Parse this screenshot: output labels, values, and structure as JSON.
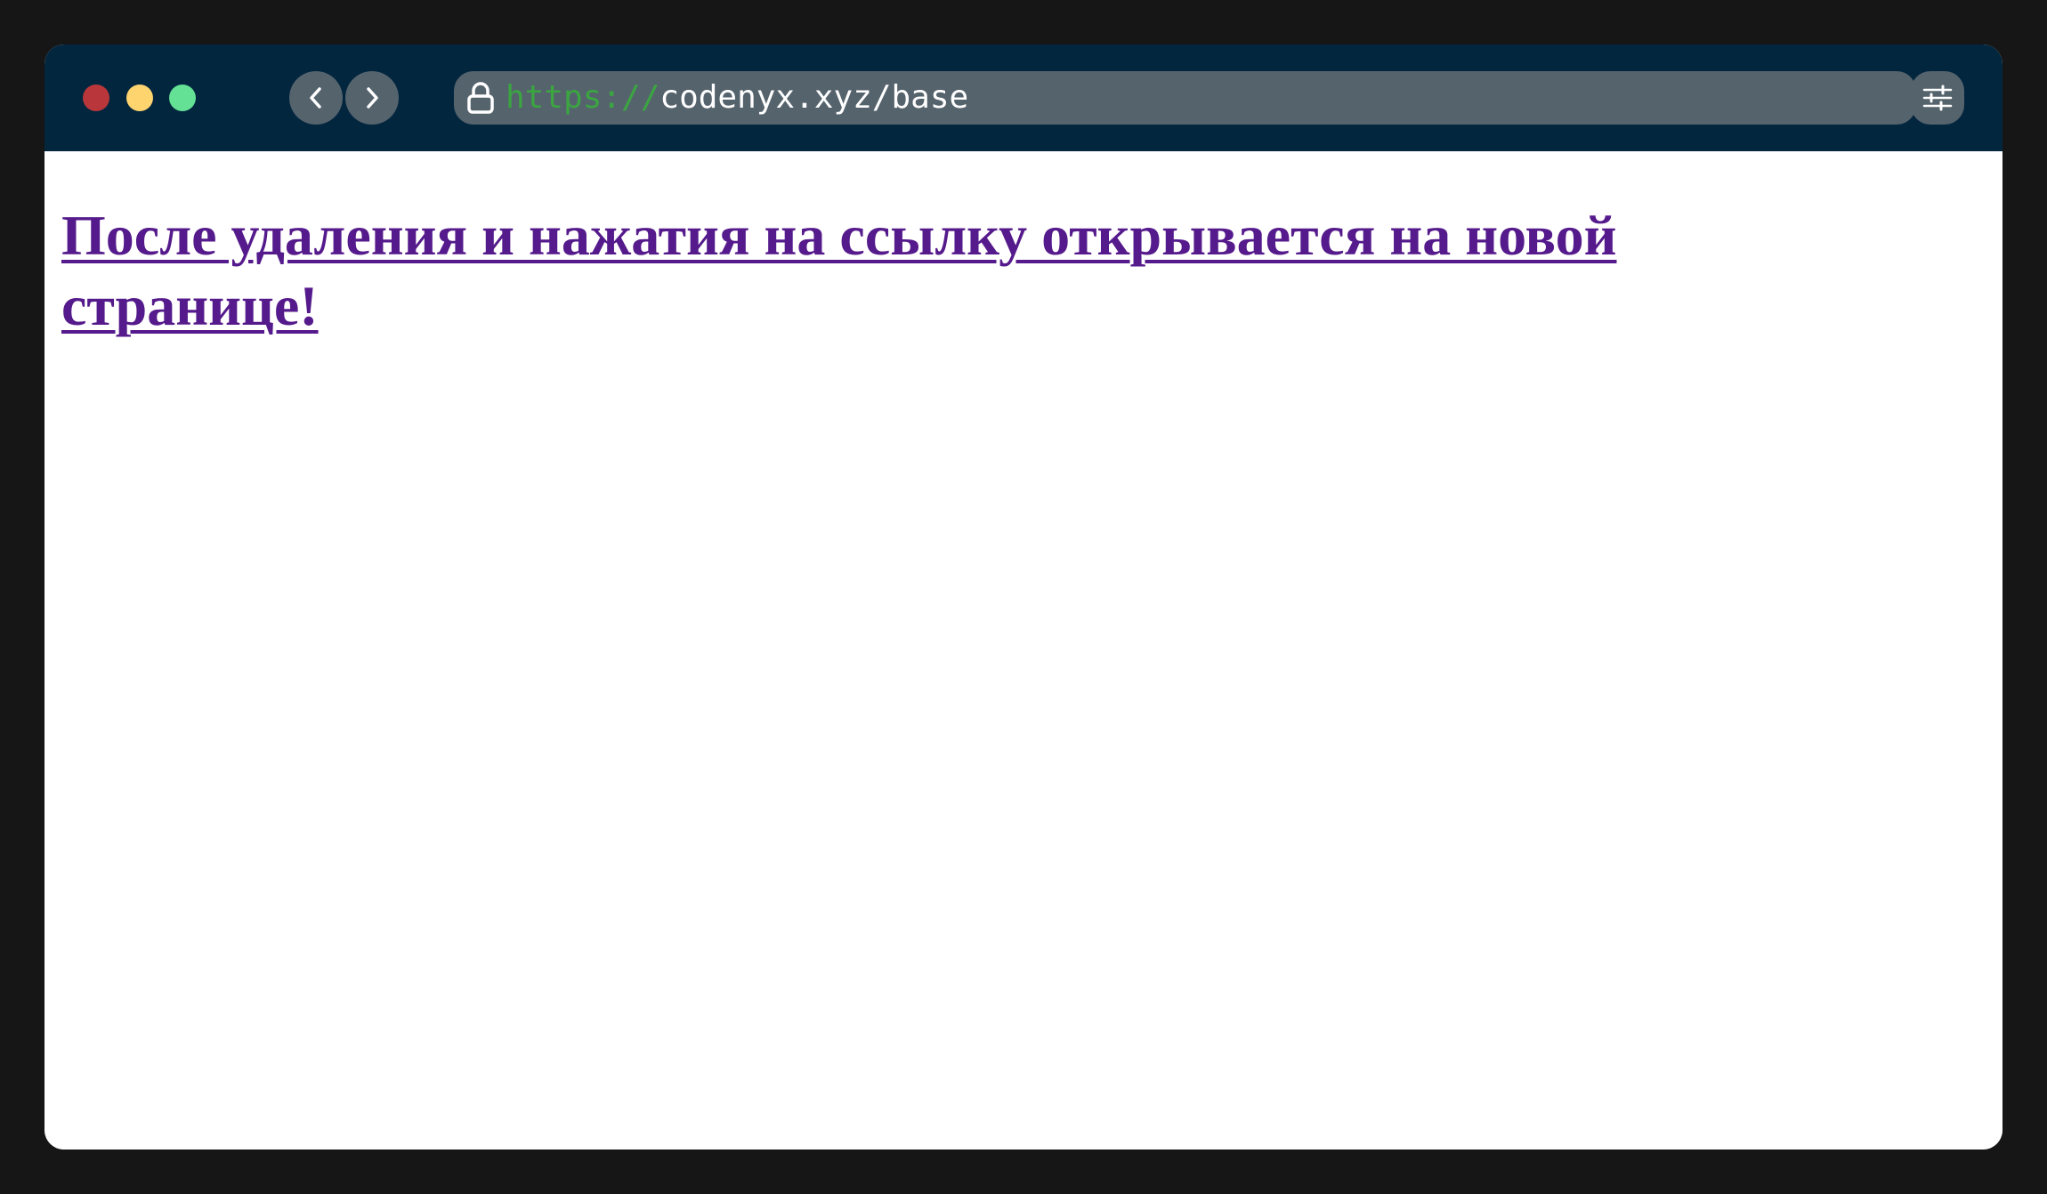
{
  "window": {
    "traffic_lights": {
      "close_color": "#b9373a",
      "minimize_color": "#fed46f",
      "maximize_color": "#64e195"
    },
    "background": "#03263f"
  },
  "toolbar": {
    "back_icon": "chevron-left-icon",
    "forward_icon": "chevron-right-icon",
    "settings_icon": "sliders-icon"
  },
  "address_bar": {
    "lock_icon": "lock-icon",
    "scheme": "https://",
    "url_rest": "codenyx.xyz/base",
    "scheme_color": "#3ba541"
  },
  "page": {
    "link_text": "После удаления и нажатия на ссылку открывается на новой странице!",
    "link_color": "#551a8b"
  }
}
